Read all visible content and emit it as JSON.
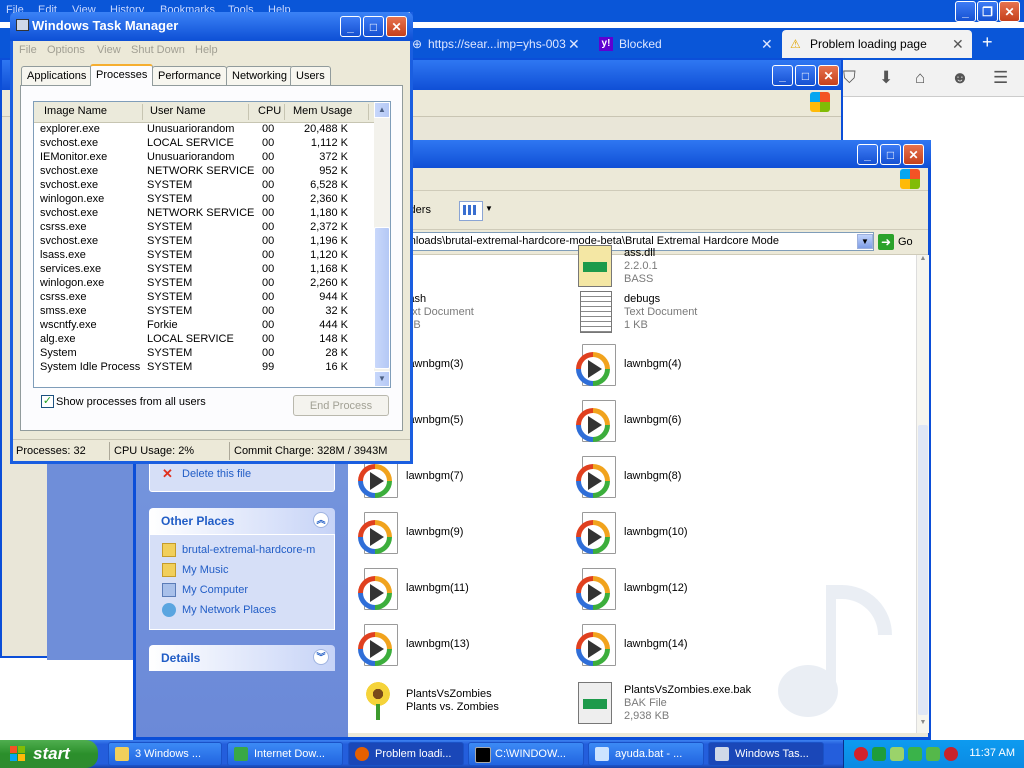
{
  "firefox": {
    "menu": [
      "File",
      "Edit",
      "View",
      "History",
      "Bookmarks",
      "Tools",
      "Help"
    ],
    "tabs": [
      {
        "label": "https://sear...imp=yhs-003",
        "active": false
      },
      {
        "label": "Blocked",
        "active": false
      },
      {
        "label": "Problem loading page",
        "active": true
      }
    ],
    "new_tab": "+"
  },
  "explorer": {
    "toolbar": {
      "folders_label": "olders"
    },
    "address": "ocuments\\Downloads\\brutal-extremal-hardcore-mode-beta\\Brutal Extremal Hardcore Mode",
    "go_label": "Go",
    "file_tasks": {
      "delete_label": "Delete this file"
    },
    "other_places": {
      "title": "Other Places",
      "links": [
        "brutal-extremal-hardcore-m",
        "My Music",
        "My Computer",
        "My Network Places"
      ]
    },
    "details": {
      "title": "Details"
    },
    "files": {
      "bass": {
        "l1": "ass.dll",
        "l2": "2.2.0.1",
        "l3": "BASS"
      },
      "flash": {
        "l1": "lash",
        "l2": "ext Document",
        "l3": "KB"
      },
      "debugs": {
        "l1": "debugs",
        "l2": "Text Document",
        "l3": "1 KB"
      },
      "bgm3": "lawnbgm(3)",
      "bgm4": "lawnbgm(4)",
      "bgm5": "lawnbgm(5)",
      "bgm6": "lawnbgm(6)",
      "bgm7": "lawnbgm(7)",
      "bgm8": "lawnbgm(8)",
      "bgm9": "lawnbgm(9)",
      "bgm10": "lawnbgm(10)",
      "bgm11": "lawnbgm(11)",
      "bgm12": "lawnbgm(12)",
      "bgm13": "lawnbgm(13)",
      "bgm14": "lawnbgm(14)",
      "pvz": {
        "l1": "PlantsVsZombies",
        "l2": "Plants vs. Zombies"
      },
      "bak": {
        "l1": "PlantsVsZombies.exe.bak",
        "l2": "BAK File",
        "l3": "2,938 KB"
      }
    }
  },
  "taskmgr": {
    "title": "Windows Task Manager",
    "menu": [
      "File",
      "Options",
      "View",
      "Shut Down",
      "Help"
    ],
    "tabs": [
      "Applications",
      "Processes",
      "Performance",
      "Networking",
      "Users"
    ],
    "active_tab": "Processes",
    "columns": [
      "Image Name",
      "User Name",
      "CPU",
      "Mem Usage"
    ],
    "rows": [
      [
        "explorer.exe",
        "Unusuariorandom",
        "00",
        "20,488 K"
      ],
      [
        "svchost.exe",
        "LOCAL SERVICE",
        "00",
        "1,112 K"
      ],
      [
        "IEMonitor.exe",
        "Unusuariorandom",
        "00",
        "372 K"
      ],
      [
        "svchost.exe",
        "NETWORK SERVICE",
        "00",
        "952 K"
      ],
      [
        "svchost.exe",
        "SYSTEM",
        "00",
        "6,528 K"
      ],
      [
        "winlogon.exe",
        "SYSTEM",
        "00",
        "2,360 K"
      ],
      [
        "svchost.exe",
        "NETWORK SERVICE",
        "00",
        "1,180 K"
      ],
      [
        "csrss.exe",
        "SYSTEM",
        "00",
        "2,372 K"
      ],
      [
        "svchost.exe",
        "SYSTEM",
        "00",
        "1,196 K"
      ],
      [
        "lsass.exe",
        "SYSTEM",
        "00",
        "1,120 K"
      ],
      [
        "services.exe",
        "SYSTEM",
        "00",
        "1,168 K"
      ],
      [
        "winlogon.exe",
        "SYSTEM",
        "00",
        "2,260 K"
      ],
      [
        "csrss.exe",
        "SYSTEM",
        "00",
        "944 K"
      ],
      [
        "smss.exe",
        "SYSTEM",
        "00",
        "32 K"
      ],
      [
        "wscntfy.exe",
        "Forkie",
        "00",
        "444 K"
      ],
      [
        "alg.exe",
        "LOCAL SERVICE",
        "00",
        "148 K"
      ],
      [
        "System",
        "SYSTEM",
        "00",
        "28 K"
      ],
      [
        "System Idle Process",
        "SYSTEM",
        "99",
        "16 K"
      ]
    ],
    "show_all_label": "Show processes from all users",
    "show_all_checked": true,
    "end_process_label": "End Process",
    "status": {
      "processes": "Processes: 32",
      "cpu": "CPU Usage: 2%",
      "commit": "Commit Charge: 328M / 3943M"
    }
  },
  "taskbar": {
    "start_label": "start",
    "buttons": [
      "3 Windows ...",
      "Internet Dow...",
      "Problem loadi...",
      "C:\\WINDOW...",
      "ayuda.bat - ...",
      "Windows Tas..."
    ],
    "clock": "11:37 AM"
  },
  "colors": {
    "xp_blue": "#0b4ed8",
    "taskbar_blue": "#245edc",
    "start_green": "#2f8b2f",
    "link_blue": "#215dc6"
  }
}
